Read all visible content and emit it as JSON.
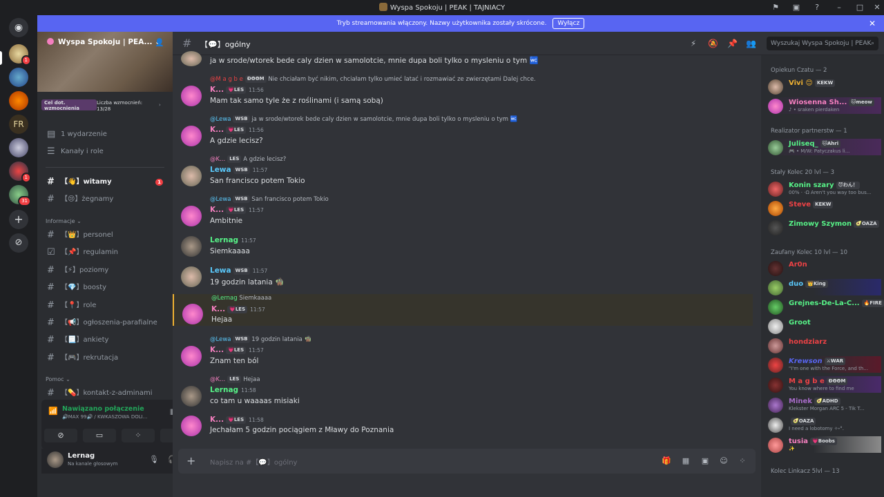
{
  "window": {
    "title": "Wyspa Spokoju | PEAK | TAJNIACY"
  },
  "stream_banner": {
    "text": "Tryb streamowania włączony. Nazwy użytkownika zostały skrócone.",
    "button": "Wyłącz",
    "close": "✕"
  },
  "guilds": [
    {
      "badge": "1"
    },
    {
      "badge": ""
    },
    {
      "badge": ""
    },
    {
      "badge": ""
    },
    {
      "badge": ""
    },
    {
      "badge": "1"
    },
    {
      "badge": "31"
    }
  ],
  "sidebar": {
    "server_name": "Wyspa Spokoju | PEA...",
    "boost_goal": "Cel dot. wzmocnienia",
    "boost_count_label": "Liczba wzmocnień:",
    "boost_count": "13/28",
    "events": "1 wydarzenie",
    "channels_roles": "Kanały i role",
    "top_channels": [
      {
        "name": "【👋】witamy",
        "badge": "1"
      },
      {
        "name": "【😢】żegnamy"
      }
    ],
    "cat_info": "Informacje",
    "info_channels": [
      "【👑】personel",
      "【📌】regulamin",
      "【⚡】poziomy",
      "【💎】boosty",
      "【📍】role",
      "【📢】ogłoszenia-parafialne",
      "【📃】ankiety",
      "【🎮】rekrutacja"
    ],
    "cat_help": "Pomoc",
    "help_channels": [
      "【💊】kontakt-z-adminami"
    ]
  },
  "voice": {
    "status": "Nawiązano połączenie",
    "server": "🔊MAX 99🔊 / KWKASZOWA DOLI..."
  },
  "user": {
    "name": "Lernag",
    "status": "Na kanale głosowym"
  },
  "channel": {
    "name": "【💬】ogólny",
    "search_placeholder": "Wyszukaj Wyspa Spokoju | PEAK ..."
  },
  "messages": [
    {
      "text": "ja w srode/wtorek bede caly dzien w samolotcie, mnie dupa boli tylko o mysleniu o tym 🚾"
    },
    {
      "reply_name": "@M a g b e",
      "reply_tag": "ÐΘΘM",
      "reply_text": "Nie chciałam być nikim, chciałam tylko umieć latać i rozmawiać ze zwierzętami Dalej chce.",
      "author": "K...",
      "tag": "💗LES",
      "time": "11:56",
      "text": "Mam tak samo tyle że z roślinami (i samą sobą)"
    },
    {
      "reply_name": "@Lewa",
      "reply_tag": "WSB",
      "reply_text": "ja w srode/wtorek bede caly dzien w samolotcie, mnie dupa boli tylko o mysleniu o tym 🚾",
      "author": "K...",
      "tag": "💗LES",
      "time": "11:56",
      "text": "A gdzie lecisz?"
    },
    {
      "reply_name": "@K...",
      "reply_tag": "LES",
      "reply_text": "A gdzie lecisz?",
      "author": "Lewa",
      "tag": "WSB",
      "time": "11:57",
      "text": "San francisco potem Tokio"
    },
    {
      "reply_name": "@Lewa",
      "reply_tag": "WSB",
      "reply_text": "San francisco potem Tokio",
      "author": "K...",
      "tag": "💗LES",
      "time": "11:57",
      "text": "Ambitnie"
    },
    {
      "author": "Lernag",
      "time": "11:57",
      "text": "Siemkaaaa"
    },
    {
      "author": "Lewa",
      "tag": "WSB",
      "time": "11:57",
      "text": "19 godzin latania 🧌"
    },
    {
      "reply_name": "@Lernag",
      "reply_text": "Siemkaaaa",
      "author": "K...",
      "tag": "💗LES",
      "time": "11:57",
      "text": "Hejaa"
    },
    {
      "reply_name": "@Lewa",
      "reply_tag": "WSB",
      "reply_text": "19 godzin latania 🧌",
      "author": "K...",
      "tag": "💗LES",
      "time": "11:57",
      "text": "Znam ten ból"
    },
    {
      "reply_name": "@K...",
      "reply_tag": "LES",
      "reply_text": "Hejaa",
      "author": "Lernag",
      "time": "11:58",
      "text": "co tam u waaaas misiaki"
    },
    {
      "author": "K...",
      "tag": "💗LES",
      "time": "11:58",
      "text": "Jechałam 5 godzin pociągiem z Mławy do Poznania"
    }
  ],
  "composer": {
    "placeholder": "Napisz na #【💬】ogólny"
  },
  "members": {
    "cats": [
      "Opiekun Czatu — 2",
      "Realizator partnerstw — 1",
      "Stały Kolec 20 lvl — 3",
      "Zaufany Kolec 10 lvl — 10",
      "Kolec Linkacz 5lvl — 13"
    ],
    "list": [
      {
        "name": "Vivi 😊",
        "tag": "KEKW",
        "status": "",
        "color": "#f0b232"
      },
      {
        "name": "Wiosenna Sh...",
        "tag": "🐱meow",
        "status": "♪ • sraken pierdaken",
        "color": "#f47fbf"
      },
      {
        "name": "Juliseq_",
        "tag": "🐱Ahri",
        "status": "🎮 • M/W: Patyczakus li...",
        "color": "#57f287"
      },
      {
        "name": "Konin szary",
        "tag": "😈わん！",
        "status": "00% · ·Ω Aren't you way too bus...",
        "color": "#57f287"
      },
      {
        "name": "Steve",
        "tag": "KEKW",
        "status": "",
        "color": "#ed4245"
      },
      {
        "name": "Zimowy Szymon",
        "tag": "🥑OAZA",
        "status": "",
        "color": "#57f287"
      },
      {
        "name": "Ar0n",
        "tag": "",
        "status": "",
        "color": "#ed4245"
      },
      {
        "name": "duo",
        "tag": "👑King",
        "status": "",
        "color": "#5ac8fa"
      },
      {
        "name": "Grejnes-De-La-C...",
        "tag": "🔥FIRE",
        "status": "",
        "color": "#57f287"
      },
      {
        "name": "Groot",
        "tag": "",
        "status": "",
        "color": "#57f287"
      },
      {
        "name": "hondziarz",
        "tag": "",
        "status": "",
        "color": "#ed4245"
      },
      {
        "name": "Krewson",
        "tag": "⚔WAR",
        "status": "\"I'm one with the Force, and th...",
        "color": "#5865f2"
      },
      {
        "name": "M a g b e",
        "tag": "ÐΘΘM",
        "status": "You know where to find me",
        "color": "#ed4245"
      },
      {
        "name": "Minek",
        "tag": "🥑ADHD",
        "status": "Klekster Morgan ARC 5 - Tik T...",
        "color": "#a66bc7"
      },
      {
        "name": "",
        "tag": "🥑OAZA",
        "status": "I need a lobotomy ✧˖°.",
        "color": "#dbdee1"
      },
      {
        "name": "tusia",
        "tag": "💗Boobs",
        "status": "✨",
        "color": "#f47fbf"
      }
    ]
  }
}
